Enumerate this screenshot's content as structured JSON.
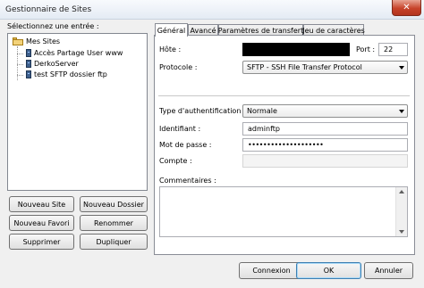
{
  "window": {
    "title": "Gestionnaire de Sites",
    "close_glyph": "✕"
  },
  "left": {
    "select_label": "Sélectionnez une entrée :",
    "tree": {
      "root": "Mes Sites",
      "items": [
        "Accès Partage User www",
        "DerkoServer",
        "test SFTP dossier ftp"
      ]
    },
    "buttons": {
      "new_site": "Nouveau Site",
      "new_folder": "Nouveau Dossier",
      "new_bookmark": "Nouveau Favori",
      "rename": "Renommer",
      "delete": "Supprimer",
      "duplicate": "Dupliquer"
    }
  },
  "tabs": [
    "Général",
    "Avancé",
    "Paramètres de transfert",
    "Jeu de caractères"
  ],
  "general": {
    "host_label": "Hôte :",
    "host_value": "",
    "port_label": "Port :",
    "port_value": "22",
    "protocol_label": "Protocole :",
    "protocol_value": "SFTP - SSH File Transfer Protocol",
    "auth_type_label": "Type d'authentification :",
    "auth_type_value": "Normale",
    "user_label": "Identifiant :",
    "user_value": "adminftp",
    "password_label": "Mot de passe :",
    "password_value": "••••••••••••••••••••",
    "account_label": "Compte :",
    "account_value": "",
    "comments_label": "Commentaires :",
    "comments_value": ""
  },
  "footer": {
    "connect": "Connexion",
    "ok": "OK",
    "cancel": "Annuler"
  },
  "colors": {
    "redacted": "#000000",
    "close_button": "#c7432a"
  }
}
